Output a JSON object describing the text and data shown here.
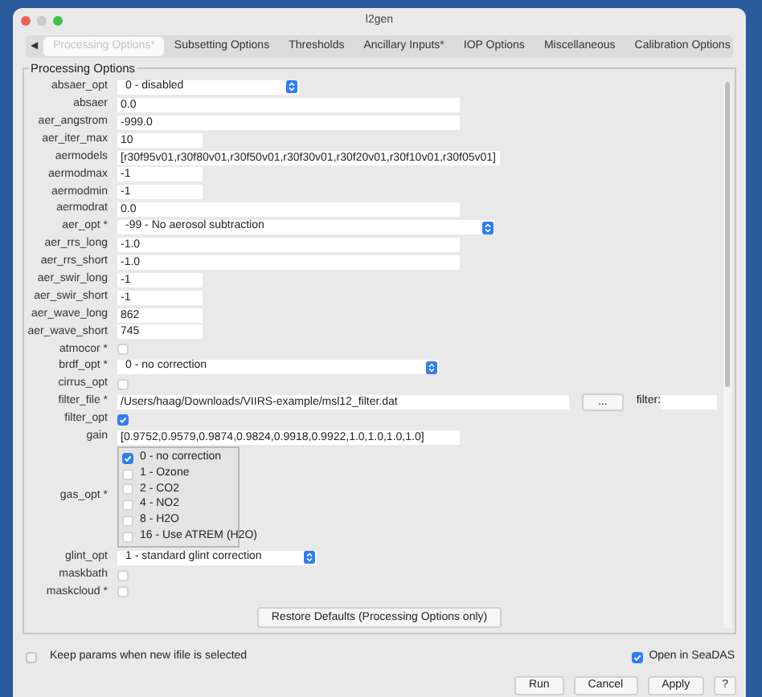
{
  "window": {
    "title": "l2gen"
  },
  "tab_scroll": "◀",
  "tabs": [
    {
      "label": "Processing Options*",
      "selected": true
    },
    {
      "label": "Subsetting Options",
      "selected": false
    },
    {
      "label": "Thresholds",
      "selected": false
    },
    {
      "label": "Ancillary Inputs*",
      "selected": false
    },
    {
      "label": "IOP Options",
      "selected": false
    },
    {
      "label": "Miscellaneous",
      "selected": false
    },
    {
      "label": "Calibration Options",
      "selected": false
    }
  ],
  "group": {
    "title": "Processing Options"
  },
  "options": [
    {
      "label": "absaer_opt",
      "kind": "combo",
      "value": "0 - disabled"
    },
    {
      "label": "absaer",
      "kind": "text",
      "value": "0.0"
    },
    {
      "label": "aer_angstrom",
      "kind": "text",
      "value": "-999.0"
    },
    {
      "label": "aer_iter_max",
      "kind": "short",
      "value": "10"
    },
    {
      "label": "aermodels",
      "kind": "text",
      "value": "[r30f95v01,r30f80v01,r30f50v01,r30f30v01,r30f20v01,r30f10v01,r30f05v01]"
    },
    {
      "label": "aermodmax",
      "kind": "short",
      "value": "-1"
    },
    {
      "label": "aermodmin",
      "kind": "short",
      "value": "-1"
    },
    {
      "label": "aermodrat",
      "kind": "text",
      "value": "0.0"
    },
    {
      "label": "aer_opt *",
      "kind": "combo",
      "value": "-99 - No aerosol subtraction"
    },
    {
      "label": "aer_rrs_long",
      "kind": "text",
      "value": "-1.0"
    },
    {
      "label": "aer_rrs_short",
      "kind": "text",
      "value": "-1.0"
    },
    {
      "label": "aer_swir_long",
      "kind": "short",
      "value": "-1"
    },
    {
      "label": "aer_swir_short",
      "kind": "short",
      "value": "-1"
    },
    {
      "label": "aer_wave_long",
      "kind": "short",
      "value": "862"
    },
    {
      "label": "aer_wave_short",
      "kind": "short",
      "value": "745"
    },
    {
      "label": "atmocor *",
      "kind": "checkbox",
      "checked": false
    },
    {
      "label": "brdf_opt *",
      "kind": "combo",
      "value": "0 - no correction"
    },
    {
      "label": "cirrus_opt",
      "kind": "checkbox",
      "checked": false
    },
    {
      "label": "filter_file *",
      "kind": "file",
      "value": "/Users/haag/Downloads/VIIRS-example/msl12_filter.dat",
      "browse": "...",
      "filter_label": "filter:"
    },
    {
      "label": "filter_opt",
      "kind": "checkbox",
      "checked": true
    },
    {
      "label": "gain",
      "kind": "text",
      "value": "[0.9752,0.9579,0.9874,0.9824,0.9918,0.9922,1.0,1.0,1.0,1.0]"
    },
    {
      "label": "gas_opt *",
      "kind": "checklist",
      "items": [
        {
          "label": "0 - no correction",
          "checked": true
        },
        {
          "label": "1 - Ozone",
          "checked": false
        },
        {
          "label": "2 - CO2",
          "checked": false
        },
        {
          "label": "4 - NO2",
          "checked": false
        },
        {
          "label": "8 - H2O",
          "checked": false
        },
        {
          "label": "16 - Use ATREM (H2O)",
          "checked": false
        }
      ]
    },
    {
      "label": "glint_opt",
      "kind": "combo",
      "value": "1 - standard glint correction"
    },
    {
      "label": "maskbath",
      "kind": "checkbox",
      "checked": false
    },
    {
      "label": "maskcloud *",
      "kind": "checkbox",
      "checked": false
    }
  ],
  "restore_button": "Restore Defaults (Processing Options only)",
  "keep_params": {
    "label": "Keep params when new ifile is selected",
    "checked": false
  },
  "open_in_seadas": {
    "label": "Open in SeaDAS",
    "checked": true
  },
  "buttons": [
    "Run",
    "Cancel",
    "Apply",
    "?"
  ]
}
